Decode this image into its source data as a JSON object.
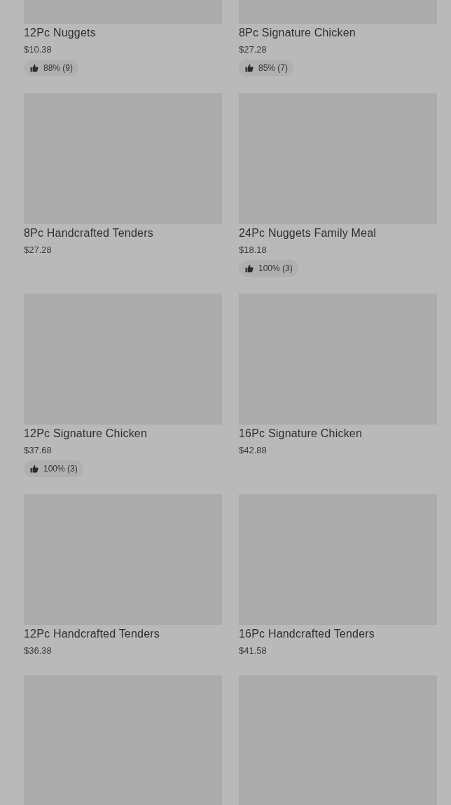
{
  "products": [
    {
      "image": {
        "kind": "picture"
      },
      "name": "12Pc Nuggets",
      "price": "$10.38",
      "rating": "88% (9)"
    },
    {
      "image": {
        "kind": "picture"
      },
      "name": "8Pc Signature Chicken",
      "price": "$27.28",
      "rating": "85% (7)"
    },
    {
      "image": {
        "kind": "picture"
      },
      "name": "8Pc Handcrafted Tenders",
      "price": "$27.28"
    },
    {
      "image": {
        "kind": "picture"
      },
      "name": "24Pc Nuggets Family Meal",
      "price": "$18.18",
      "rating": "100% (3)"
    },
    {
      "image": {
        "kind": "picture"
      },
      "name": "12Pc Signature Chicken",
      "price": "$37.68",
      "rating": "100% (3)"
    },
    {
      "image": {
        "kind": "picture"
      },
      "name": "16Pc Signature Chicken",
      "price": "$42.88"
    },
    {
      "image": {
        "kind": "picture"
      },
      "name": "12Pc Handcrafted Tenders",
      "price": "$36.38"
    },
    {
      "image": {
        "kind": "picture"
      },
      "name": "16Pc Handcrafted Tenders",
      "price": "$41.58"
    },
    {
      "image": {
        "kind": "picture"
      }
    },
    {
      "image": {
        "kind": "picture"
      }
    }
  ]
}
